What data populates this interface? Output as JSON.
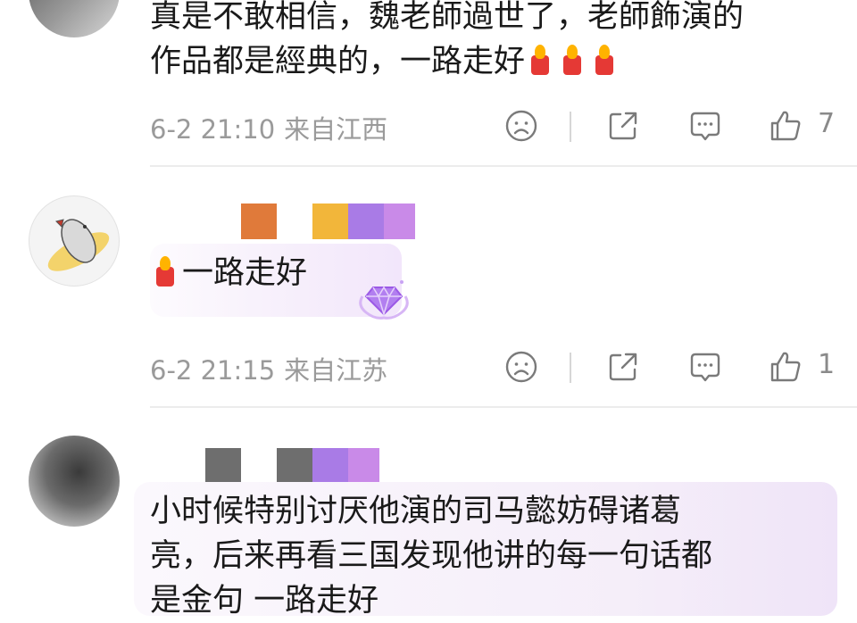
{
  "comments": [
    {
      "text_lines": [
        "真是不敢相信，魏老師過世了，老師飾演的",
        "作品都是經典的，一路走好"
      ],
      "emoji": "candle-icon",
      "time": "6-2 21:10",
      "location": "来自江西",
      "likes": "7"
    },
    {
      "text": "一路走好",
      "emoji": "candle-icon",
      "time": "6-2 21:15",
      "location": "来自江苏",
      "likes": "1"
    },
    {
      "text_lines": [
        "小时候特别讨厌他演的司马懿妨碍诸葛",
        "亮，后来再看三国发现他讲的每一句话都",
        "是金句   一路走好"
      ]
    }
  ],
  "colors": {
    "meta_text": "#9a9a9a",
    "redaction_blocks_2": [
      "#e07a3a",
      "#ffffff",
      "#f2b63a",
      "#a97be6",
      "#c98ae8"
    ],
    "redaction_blocks_3": [
      "#6e6e6e",
      "#ffffff",
      "#6e6e6e",
      "#a97be6",
      "#c98ae8"
    ]
  },
  "icons": {
    "dislike": "sad-face-icon",
    "share": "share-icon",
    "comment": "comment-icon",
    "like": "thumbs-up-icon"
  }
}
